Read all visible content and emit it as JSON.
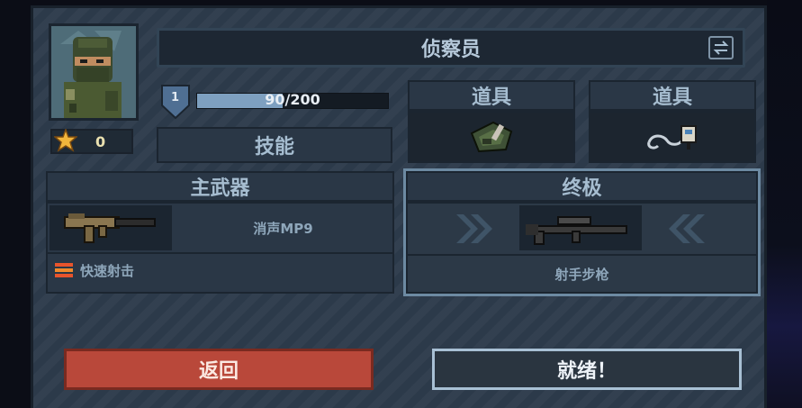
{
  "character": {
    "name": "侦察员",
    "stars": "0",
    "level": "1",
    "xp_text": "90/200",
    "xp_progress": 0.45
  },
  "skills_label": "技能",
  "items": [
    {
      "label": "道具",
      "icon": "ammo-bag-icon"
    },
    {
      "label": "道具",
      "icon": "detonator-icon"
    }
  ],
  "primary_weapon": {
    "header": "主武器",
    "name": "消声MP9",
    "perk": "快速射击"
  },
  "ultimate": {
    "header": "终极",
    "name": "射手步枪"
  },
  "buttons": {
    "back": "返回",
    "ready": "就绪！"
  },
  "colors": {
    "back_button": "#b9483a",
    "ready_button": "#2a3540",
    "xp_fill": "#7ea0c0",
    "star": "#f2b63c"
  }
}
